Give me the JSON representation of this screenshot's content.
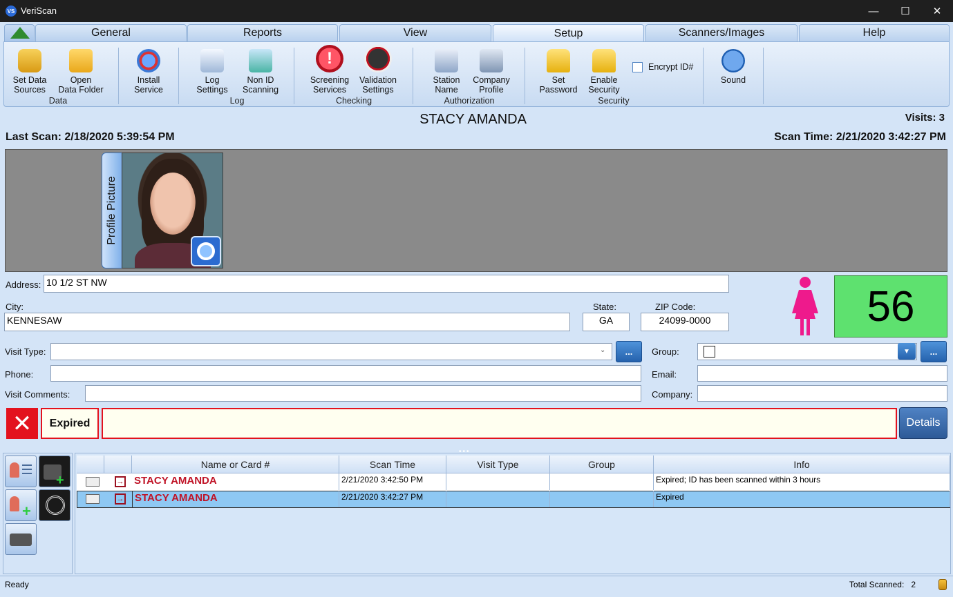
{
  "window": {
    "title": "VeriScan",
    "logo_text": "VS",
    "minimize": "—",
    "maximize": "☐",
    "close": "✕"
  },
  "tabs": [
    "General",
    "Reports",
    "View",
    "Setup",
    "Scanners/Images",
    "Help"
  ],
  "active_tab": "Setup",
  "ribbon": {
    "data": {
      "label": "Data",
      "set_data_sources": "Set Data\nSources",
      "open_data_folder": "Open\nData Folder"
    },
    "install_service": "Install\nService",
    "log": {
      "label": "Log",
      "log_settings": "Log\nSettings",
      "non_id_scanning": "Non ID\nScanning"
    },
    "checking": {
      "label": "Checking",
      "screening_services": "Screening\nServices",
      "validation_settings": "Validation\nSettings"
    },
    "authorization": {
      "label": "Authorization",
      "station_name": "Station\nName",
      "company_profile": "Company\nProfile"
    },
    "security": {
      "label": "Security",
      "set_password": "Set\nPassword",
      "enable_security": "Enable\nSecurity",
      "encrypt_id": "Encrypt ID#"
    },
    "sound": "Sound"
  },
  "person": {
    "name": "STACY AMANDA",
    "visits": "Visits: 3",
    "last_scan": "Last Scan: 2/18/2020 5:39:54 PM",
    "scan_time": "Scan Time: 2/21/2020 3:42:27 PM",
    "profile_picture_tab": "Profile Picture",
    "age": "56",
    "gender": "female"
  },
  "form": {
    "address_label": "Address:",
    "address": "10 1/2 ST NW",
    "city_label": "City:",
    "city": "KENNESAW",
    "state_label": "State:",
    "state": "GA",
    "zip_label": "ZIP Code:",
    "zip": "24099-0000",
    "visit_type_label": "Visit Type:",
    "visit_type": "",
    "group_label": "Group:",
    "group": "",
    "phone_label": "Phone:",
    "phone": "",
    "email_label": "Email:",
    "email": "",
    "visit_comments_label": "Visit Comments:",
    "visit_comments": "",
    "company_label": "Company:",
    "company": "",
    "ellipsis": "..."
  },
  "status": {
    "icon": "✕",
    "text": "Expired",
    "message": "",
    "details_button": "Details"
  },
  "grid": {
    "columns": [
      "",
      "",
      "Name or Card #",
      "Scan Time",
      "Visit Type",
      "Group",
      "Info"
    ],
    "rows": [
      {
        "name": "STACY AMANDA",
        "scan_time": "2/21/2020 3:42:50 PM",
        "visit_type": "",
        "group": "",
        "info": "Expired; ID has been scanned within 3 hours"
      },
      {
        "name": "STACY AMANDA",
        "scan_time": "2/21/2020 3:42:27 PM",
        "visit_type": "",
        "group": "",
        "info": "Expired"
      }
    ]
  },
  "statusbar": {
    "ready": "Ready",
    "total_scanned": "Total Scanned:   2"
  },
  "colors": {
    "accent": "#2562ad",
    "alert": "#e3121e",
    "age_ok": "#5ee16f",
    "female": "#ee1a8c"
  }
}
